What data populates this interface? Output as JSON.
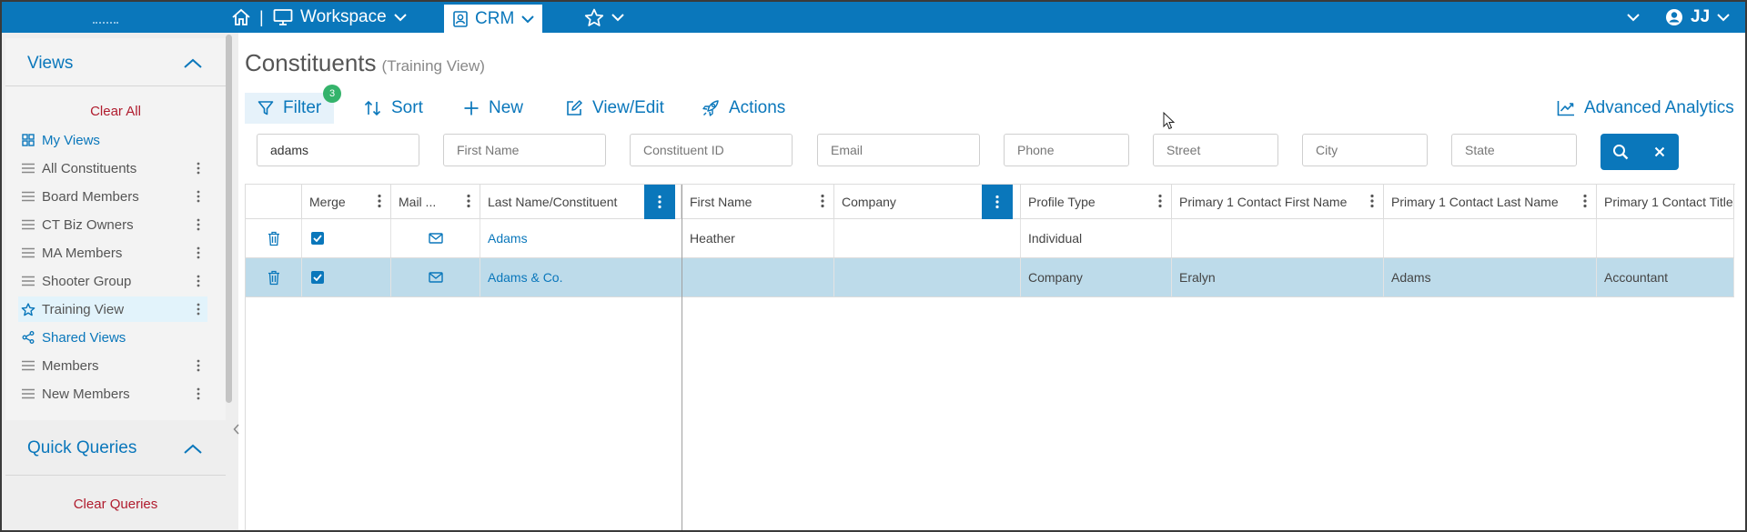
{
  "topbar": {
    "separator": "|",
    "workspace_label": "Workspace",
    "crm_label": "CRM",
    "user_initials": "JJ",
    "icons": [
      "home-icon",
      "monitor-icon",
      "contacts-icon",
      "star-icon",
      "chevron-down-icon",
      "user-circle-icon"
    ]
  },
  "sidebar": {
    "views_heading": "Views",
    "clear_all": "Clear All",
    "items": [
      {
        "label": "My Views",
        "icon": "grid-icon",
        "type": "link"
      },
      {
        "label": "All Constituents",
        "icon": "list-icon",
        "type": "view"
      },
      {
        "label": "Board Members",
        "icon": "list-icon",
        "type": "view"
      },
      {
        "label": "CT Biz Owners",
        "icon": "list-icon",
        "type": "view"
      },
      {
        "label": "MA Members",
        "icon": "list-icon",
        "type": "view"
      },
      {
        "label": "Shooter Group",
        "icon": "list-icon",
        "type": "view"
      },
      {
        "label": "Training View",
        "icon": "star-icon",
        "type": "active"
      },
      {
        "label": "Shared Views",
        "icon": "share-icon",
        "type": "link"
      },
      {
        "label": "Members",
        "icon": "list-icon",
        "type": "view"
      },
      {
        "label": "New Members",
        "icon": "list-icon",
        "type": "view"
      }
    ],
    "quick_queries_heading": "Quick Queries",
    "clear_queries": "Clear Queries"
  },
  "page": {
    "title": "Constituents",
    "subtitle": "(Training View)"
  },
  "toolbar": {
    "filter": "Filter",
    "filter_count": "3",
    "sort": "Sort",
    "new": "New",
    "view_edit": "View/Edit",
    "actions": "Actions",
    "advanced_analytics": "Advanced Analytics"
  },
  "filters": {
    "last_name_value": "adams",
    "first_name_placeholder": "First Name",
    "constituent_id_placeholder": "Constituent ID",
    "email_placeholder": "Email",
    "phone_placeholder": "Phone",
    "street_placeholder": "Street",
    "city_placeholder": "City",
    "state_placeholder": "State"
  },
  "grid": {
    "columns": [
      "Merge",
      "Mail ...",
      "Last Name/Constituent",
      "First Name",
      "Company",
      "Profile Type",
      "Primary 1 Contact First Name",
      "Primary 1 Contact Last Name",
      "Primary 1 Contact Title"
    ],
    "rows": [
      {
        "last_name": "Adams",
        "first_name": "Heather",
        "company": "",
        "profile_type": "Individual",
        "p1_first": "",
        "p1_last": "",
        "p1_title": "",
        "merge": true,
        "selected": false
      },
      {
        "last_name": "Adams & Co.",
        "first_name": "",
        "company": "",
        "profile_type": "Company",
        "p1_first": "Eralyn",
        "p1_last": "Adams",
        "p1_title": "Accountant",
        "merge": true,
        "selected": true
      }
    ]
  },
  "colors": {
    "brand_blue": "#0a77bb",
    "danger_red": "#b01c2e",
    "badge_green": "#34b36b",
    "selected_row": "#bddbea"
  }
}
